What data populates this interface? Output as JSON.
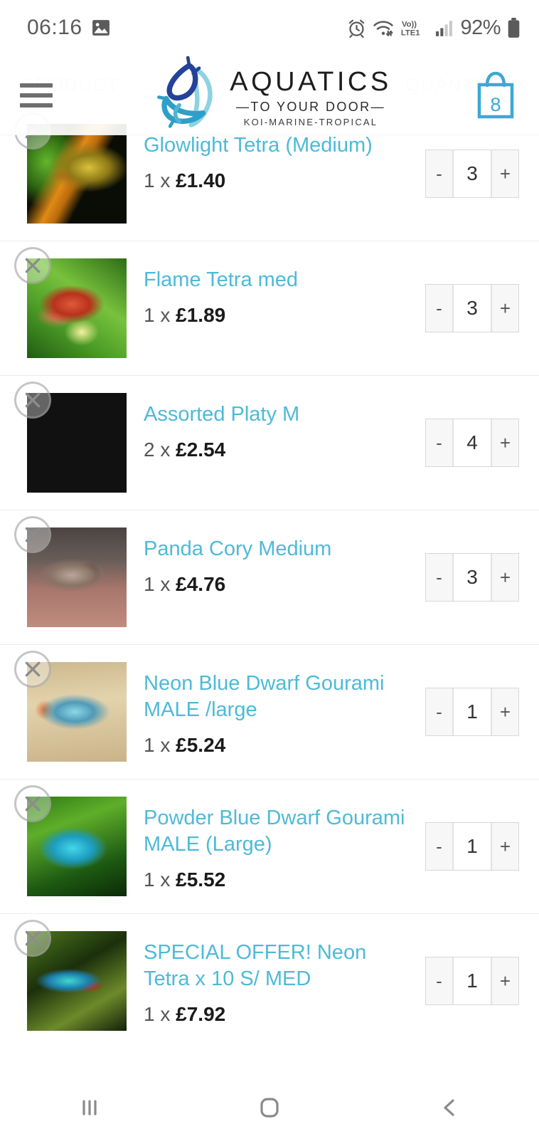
{
  "statusbar": {
    "time": "06:16",
    "icons": [
      "photo-icon",
      "alarm-icon",
      "wifi-icon",
      "volte-icon",
      "signal-icon"
    ],
    "network_label": "Vo)) LTE1",
    "battery_percent": "92%"
  },
  "header": {
    "menu_icon": "hamburger-menu-icon",
    "logo": {
      "mark": "three-fish-logo-icon",
      "title": "AQUATICS",
      "tagline": "—TO YOUR DOOR—",
      "subtitle": "KOI-MARINE-TROPICAL",
      "colors": {
        "dark_blue": "#24429a",
        "mid_blue": "#2f9fc8",
        "light_blue": "#8fd0e0"
      }
    },
    "cart": {
      "icon": "shopping-bag-icon",
      "count": "8",
      "color": "#3aa9d4"
    }
  },
  "table_head": {
    "product": "PRODUCT",
    "quantity": "QUANTITY"
  },
  "theme": {
    "link_color": "#4dbad8",
    "accent_color": "#3aa9d4",
    "divider_color": "#ececec"
  },
  "cart_items": [
    {
      "title": "Glowlight Tetra (Medium)",
      "price_line": "1 x ",
      "price": "£1.40",
      "qty": "3",
      "minus": "-",
      "plus": "+",
      "remove": "remove-item-icon",
      "thumb": "glowlight-tetra-photo"
    },
    {
      "title": "Flame Tetra med",
      "price_line": "1 x ",
      "price": "£1.89",
      "qty": "3",
      "minus": "-",
      "plus": "+",
      "remove": "remove-item-icon",
      "thumb": "flame-tetra-photo"
    },
    {
      "title": "Assorted Platy M",
      "price_line": "2 x ",
      "price": "£2.54",
      "qty": "4",
      "minus": "-",
      "plus": "+",
      "remove": "remove-item-icon",
      "thumb": "assorted-platy-photo-grid"
    },
    {
      "title": "Panda Cory Medium",
      "price_line": "1 x ",
      "price": "£4.76",
      "qty": "3",
      "minus": "-",
      "plus": "+",
      "remove": "remove-item-icon",
      "thumb": "panda-cory-photo"
    },
    {
      "title": "Neon Blue Dwarf Gourami MALE /large",
      "price_line": "1 x ",
      "price": "£5.24",
      "qty": "1",
      "minus": "-",
      "plus": "+",
      "remove": "remove-item-icon",
      "thumb": "neon-blue-dwarf-gourami-photo"
    },
    {
      "title": "Powder Blue Dwarf Gourami MALE (Large)",
      "price_line": "1 x ",
      "price": "£5.52",
      "qty": "1",
      "minus": "-",
      "plus": "+",
      "remove": "remove-item-icon",
      "thumb": "powder-blue-dwarf-gourami-photo"
    },
    {
      "title": "SPECIAL OFFER! Neon Tetra x 10 S/ MED",
      "price_line": "1 x ",
      "price": "£7.92",
      "qty": "1",
      "minus": "-",
      "plus": "+",
      "remove": "remove-item-icon",
      "thumb": "neon-tetra-photo"
    }
  ],
  "navbar": {
    "recents": "recents-icon",
    "home": "home-icon",
    "back": "back-icon"
  }
}
